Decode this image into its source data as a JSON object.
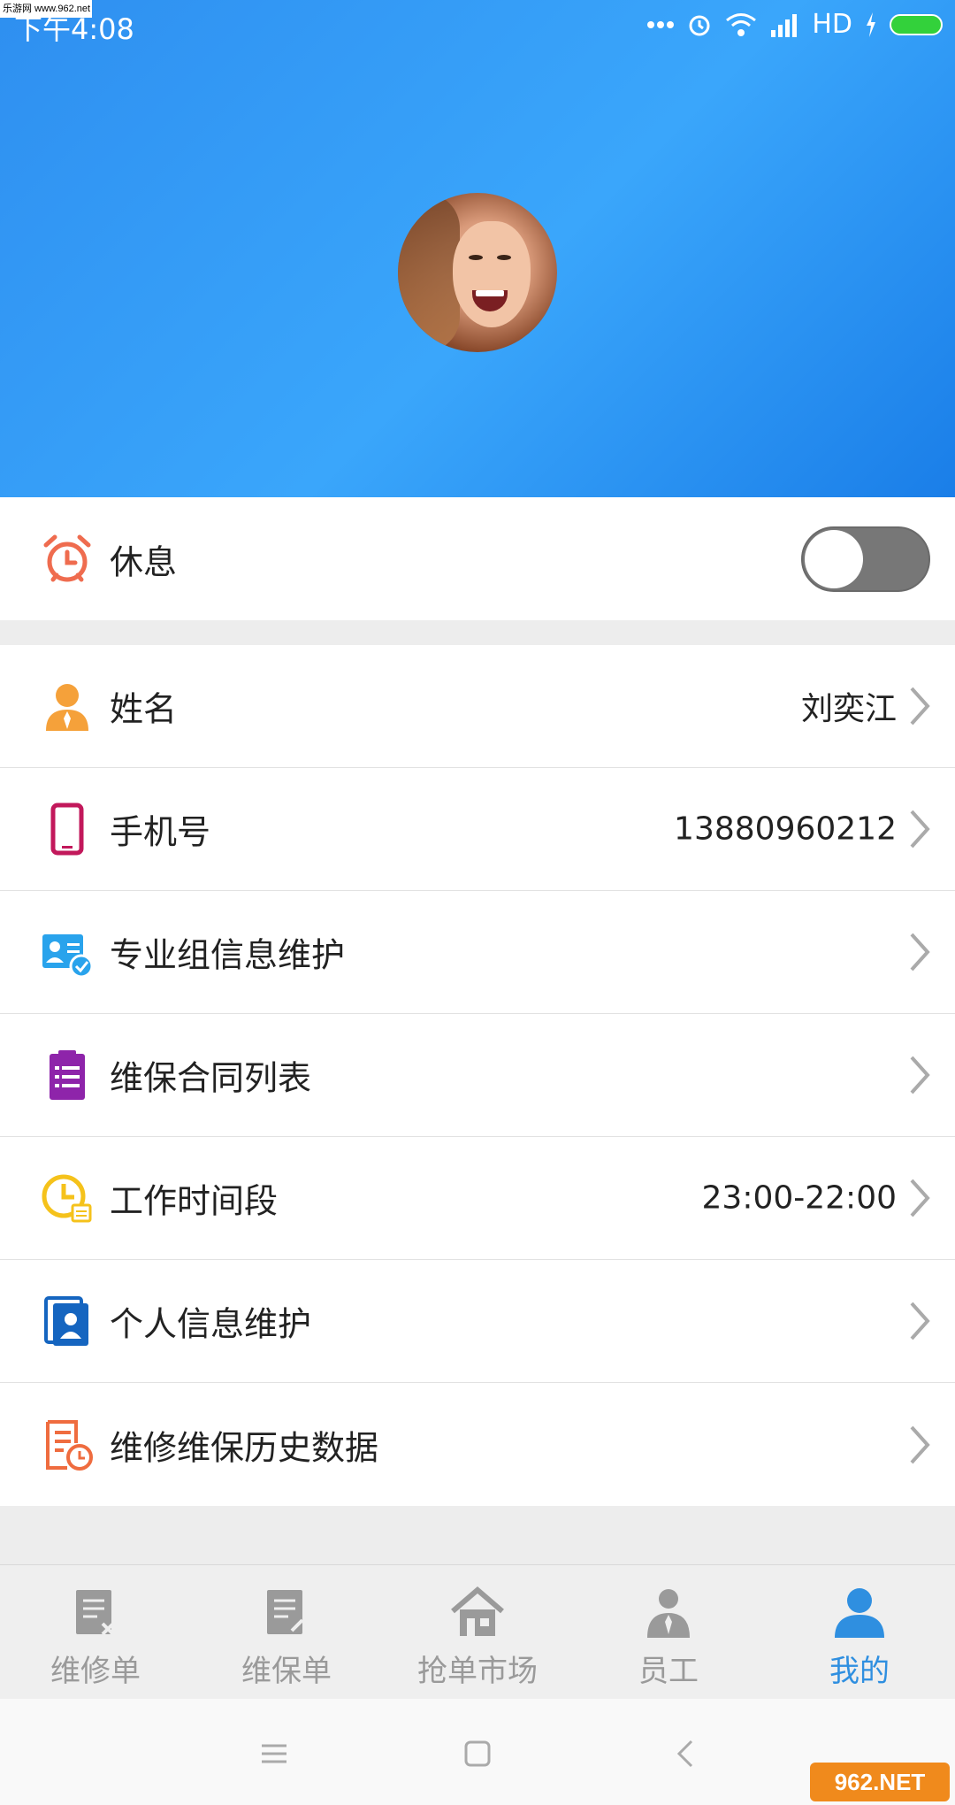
{
  "watermark_top": "乐游网 www.962.net",
  "status_bar": {
    "time": "下午4:08",
    "network": "HD"
  },
  "rest_row": {
    "label": "休息",
    "toggle_on": false
  },
  "info_rows": [
    {
      "label": "姓名",
      "value": "刘奕江",
      "icon": "user-tie-icon",
      "color": "#f5a13a"
    },
    {
      "label": "手机号",
      "value": "13880960212",
      "icon": "mobile-phone-icon",
      "color": "#c2185b"
    },
    {
      "label": "专业组信息维护",
      "value": "",
      "icon": "id-card-check-icon",
      "color": "#29a3ec"
    },
    {
      "label": "维保合同列表",
      "value": "",
      "icon": "clipboard-list-icon",
      "color": "#8e24aa"
    },
    {
      "label": "工作时间段",
      "value": "23:00-22:00",
      "icon": "clock-calendar-icon",
      "color": "#f5c21b"
    },
    {
      "label": "个人信息维护",
      "value": "",
      "icon": "contact-card-icon",
      "color": "#1565c0"
    },
    {
      "label": "维修维保历史数据",
      "value": "",
      "icon": "document-clock-icon",
      "color": "#ef6c3f"
    }
  ],
  "bottom_nav": [
    {
      "label": "维修单",
      "icon": "repair-order-icon",
      "active": false
    },
    {
      "label": "维保单",
      "icon": "maintenance-order-icon",
      "active": false
    },
    {
      "label": "抢单市场",
      "icon": "market-house-icon",
      "active": false
    },
    {
      "label": "员工",
      "icon": "employee-icon",
      "active": false
    },
    {
      "label": "我的",
      "icon": "my-profile-icon",
      "active": true
    }
  ],
  "watermark_bottom": "962.NET",
  "colors": {
    "header_blue": "#2e8ff0",
    "active_tab": "#2f8fe0",
    "inactive_tab": "#9a9a9a"
  }
}
